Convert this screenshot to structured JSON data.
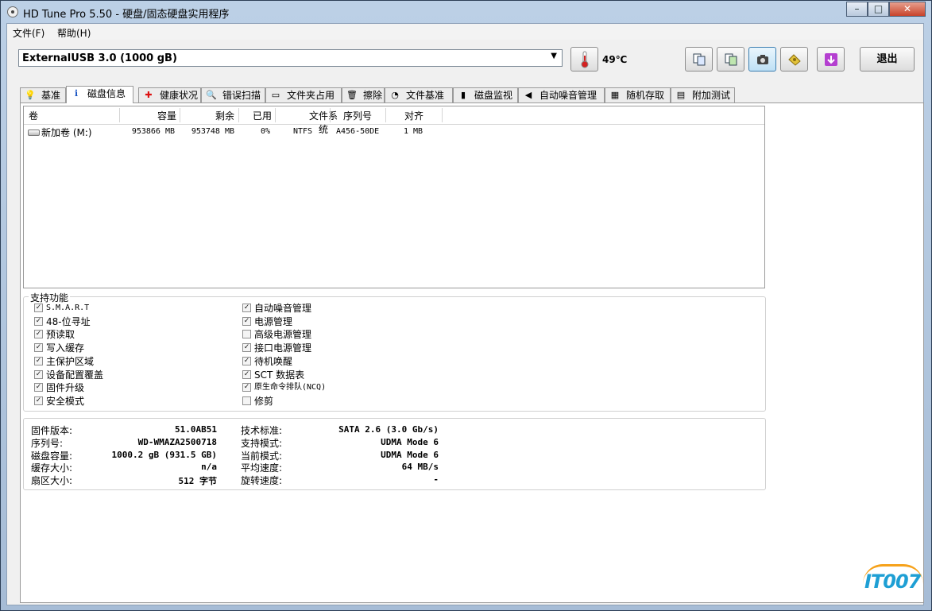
{
  "titlebar": {
    "title": "HD Tune Pro 5.50 - 硬盘/固态硬盘实用程序",
    "minimize": "–",
    "maximize": "□",
    "close": "✕"
  },
  "menu": {
    "file": "文件(F)",
    "help": "帮助(H)"
  },
  "toolbar": {
    "drive": "ExternalUSB 3.0 (1000 gB)",
    "temperature": "49℃",
    "exit": "退出",
    "icons": [
      "thermometer-icon",
      "copy-text-icon",
      "copy-all-icon",
      "screenshot-icon",
      "options-icon",
      "save-icon"
    ]
  },
  "tabs": [
    {
      "label": "基准",
      "icon": "lightbulb-icon"
    },
    {
      "label": "磁盘信息",
      "icon": "info-icon",
      "active": true
    },
    {
      "label": "健康状况",
      "icon": "health-cross-icon"
    },
    {
      "label": "错误扫描",
      "icon": "magnifier-icon"
    },
    {
      "label": "文件夹占用",
      "icon": "folder-icon"
    },
    {
      "label": "擦除",
      "icon": "trash-icon"
    },
    {
      "label": "文件基准",
      "icon": "file-benchmark-icon"
    },
    {
      "label": "磁盘监视",
      "icon": "monitor-chart-icon"
    },
    {
      "label": "自动噪音管理",
      "icon": "speaker-icon"
    },
    {
      "label": "随机存取",
      "icon": "random-access-icon"
    },
    {
      "label": "附加测试",
      "icon": "extra-tests-icon"
    }
  ],
  "volumes": {
    "headers": [
      "卷",
      "容量",
      "剩余",
      "已用",
      "文件系统",
      "序列号",
      "对齐"
    ],
    "rows": [
      {
        "name": "新加卷 (M:)",
        "capacity": "953866 MB",
        "free": "953748 MB",
        "used": "0%",
        "fs": "NTFS",
        "serial": "A456-50DE",
        "align": "1 MB"
      }
    ]
  },
  "features": {
    "title": "支持功能",
    "left": [
      {
        "label": "S.M.A.R.T",
        "checked": true
      },
      {
        "label": "48-位寻址",
        "checked": true
      },
      {
        "label": "预读取",
        "checked": true
      },
      {
        "label": "写入缓存",
        "checked": true
      },
      {
        "label": "主保护区域",
        "checked": true
      },
      {
        "label": "设备配置覆盖",
        "checked": true
      },
      {
        "label": "固件升级",
        "checked": true
      },
      {
        "label": "安全模式",
        "checked": true
      }
    ],
    "right": [
      {
        "label": "自动噪音管理",
        "checked": true
      },
      {
        "label": "电源管理",
        "checked": true
      },
      {
        "label": "高级电源管理",
        "checked": false
      },
      {
        "label": "接口电源管理",
        "checked": true
      },
      {
        "label": "待机唤醒",
        "checked": true
      },
      {
        "label": "SCT 数据表",
        "checked": true
      },
      {
        "label": "原生命令排队(NCQ)",
        "checked": true
      },
      {
        "label": "修剪",
        "checked": false
      }
    ]
  },
  "info": {
    "left": [
      {
        "label": "固件版本:",
        "value": "51.0AB51"
      },
      {
        "label": "序列号:",
        "value": "WD-WMAZA2500718"
      },
      {
        "label": "磁盘容量:",
        "value": "1000.2 gB (931.5 GB)"
      },
      {
        "label": "缓存大小:",
        "value": "n/a"
      },
      {
        "label": "扇区大小:",
        "value": "512 字节"
      }
    ],
    "right": [
      {
        "label": "技术标准:",
        "value": "SATA 2.6 (3.0 Gb/s)"
      },
      {
        "label": "支持模式:",
        "value": "UDMA Mode 6"
      },
      {
        "label": "当前模式:",
        "value": "UDMA Mode 6"
      },
      {
        "label": "平均速度:",
        "value": "64 MB/s"
      },
      {
        "label": "旋转速度:",
        "value": "-"
      }
    ]
  },
  "watermark": "IT007"
}
